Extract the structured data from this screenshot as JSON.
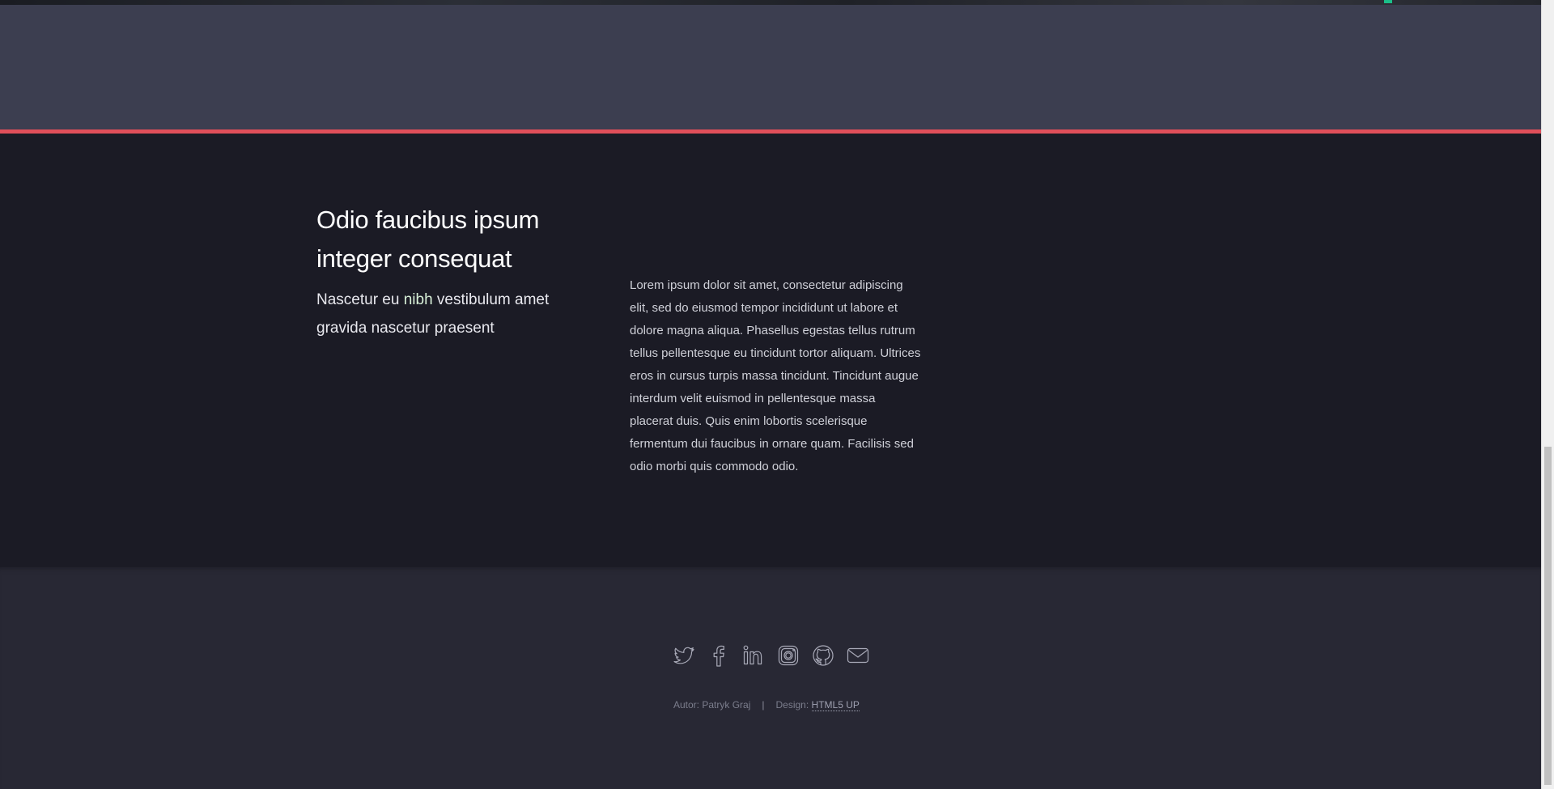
{
  "section": {
    "heading": "Odio faucibus ipsum integer consequat",
    "subheading_pre": "Nascetur eu ",
    "subheading_highlight": "nibh",
    "subheading_post": " vestibulum amet gravida nascetur praesent",
    "body": "Lorem ipsum dolor sit amet, consectetur adipiscing elit, sed do eiusmod tempor incididunt ut labore et dolore magna aliqua. Phasellus egestas tellus rutrum tellus pellentesque eu tincidunt tortor aliquam. Ultrices eros in cursus turpis massa tincidunt. Tincidunt augue interdum velit euismod in pellentesque massa placerat duis. Quis enim lobortis scelerisque fermentum dui faucibus in ornare quam. Facilisis sed odio morbi quis commodo odio."
  },
  "footer": {
    "icons": [
      "twitter-icon",
      "facebook-icon",
      "linkedin-icon",
      "instagram-icon",
      "github-icon",
      "email-icon"
    ],
    "author": "Autor: Patryk Graj",
    "separator": "|",
    "design_label": "Design: ",
    "design_link": "HTML5 UP"
  },
  "colors": {
    "accent_rule": "#e04f5a",
    "banner_bg": "#3c3e50",
    "content_bg": "#1b1b25",
    "footer_bg": "#282834"
  }
}
